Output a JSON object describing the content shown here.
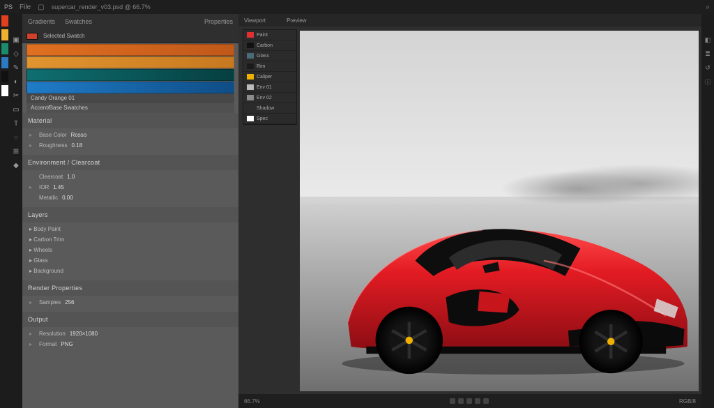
{
  "titlebar": {
    "logo": "PS",
    "menu_1": "File",
    "icon_save": "▢",
    "doc_title": "supercar_render_v03.psd @ 66.7%",
    "icon_search": "⌕"
  },
  "tool_strip": {
    "tools": [
      "▣",
      "◇",
      "✎",
      "◐",
      "✂",
      "▭",
      "T",
      "◌",
      "⊞",
      "◆"
    ]
  },
  "left_tool_swatches": [
    "#e44020",
    "#f0b030",
    "#1a8c6d",
    "#2c7ac4",
    "#111111",
    "#ffffff"
  ],
  "panel_tabs": {
    "tab1": "Gradients",
    "tab2": "Swatches",
    "tab3": "Properties"
  },
  "swatch_info": {
    "label": "Selected Swatch",
    "chip_color": "#d0402a"
  },
  "colors": {
    "c1": {
      "hex": "#e07020",
      "label": "Candy Orange 01"
    },
    "c2": {
      "hex": "#e09530",
      "label": ""
    },
    "c3": {
      "hex": "#0f6f70",
      "label": ""
    },
    "c4": {
      "hex": "#1f7cc8",
      "label": ""
    }
  },
  "color_label_2": "Accent/Base Swatches",
  "sections": {
    "s1": {
      "title": "Material",
      "rows": [
        {
          "k": "Base Color",
          "v": "Rosso"
        },
        {
          "k": "Roughness",
          "v": "0.18"
        }
      ]
    },
    "s2": {
      "title": "Environment / Clearcoat",
      "rows": [
        {
          "k": "Clearcoat",
          "v": "1.0"
        },
        {
          "k": "IOR",
          "v": "1.45"
        },
        {
          "k": "Metallic",
          "v": "0.00"
        }
      ]
    },
    "s3": {
      "title": "Layers",
      "rows": [
        {
          "k": "▸ Body Paint"
        },
        {
          "k": "▸ Carbon Trim"
        },
        {
          "k": "▸ Wheels"
        },
        {
          "k": "▸ Glass"
        },
        {
          "k": "▸ Background"
        }
      ]
    },
    "s4": {
      "title": "Render Properties",
      "rows": [
        {
          "k": "Samples",
          "v": "256"
        }
      ]
    },
    "s5": {
      "title": "Output",
      "rows": [
        {
          "k": "Resolution",
          "v": "1920×1080"
        },
        {
          "k": "Format",
          "v": "PNG"
        }
      ]
    }
  },
  "center_tabs": {
    "t1": "Viewport",
    "t2": "Preview"
  },
  "sub_panel": {
    "rows": [
      {
        "label": "Paint",
        "c": "#e23030"
      },
      {
        "label": "Carbon",
        "c": "#111111"
      },
      {
        "label": "Glass",
        "c": "#4a6a78"
      },
      {
        "label": "Rim",
        "c": "#1a1a1a"
      },
      {
        "label": "Caliper",
        "c": "#f0b000"
      },
      {
        "label": "Env 01",
        "c": "#bcbcbc"
      },
      {
        "label": "Env 02",
        "c": "#8c8c8c"
      },
      {
        "label": "Shadow",
        "c": "#2a2a2a"
      },
      {
        "label": "Spec",
        "c": "#ffffff"
      }
    ]
  },
  "status": {
    "zoom": "66.7%",
    "info": "RGB/8"
  },
  "car": {
    "body_color": "#e31b23",
    "body_dark": "#a01017",
    "trim_color": "#111111",
    "glass_color": "#1a1a1a",
    "caliper_color": "#f0b000"
  }
}
